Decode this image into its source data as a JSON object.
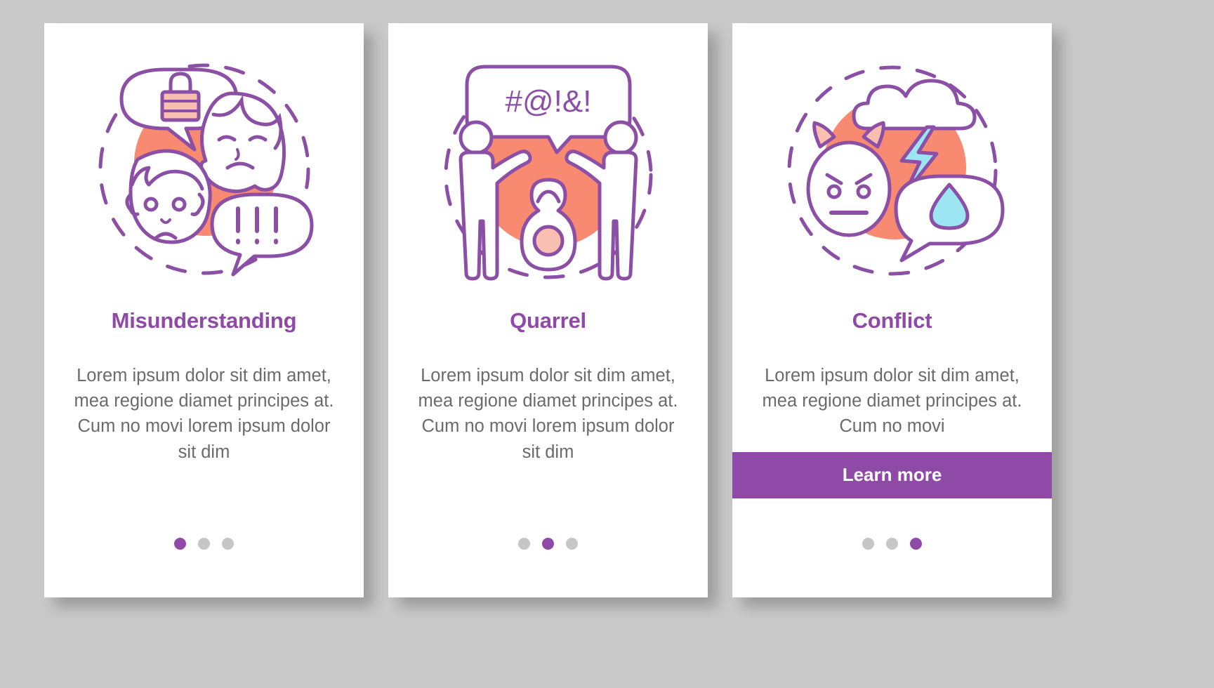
{
  "background_color": "#c9c9c9",
  "theme": {
    "accent_purple": "#8f4aa8",
    "stroke_purple": "#8b4fa5",
    "coral": "#f98a72",
    "light_pink": "#f9c0b2",
    "cyan": "#9be6f2",
    "body_text": "#6b6b6b",
    "dot_inactive": "#c6c6c6",
    "card_background": "#ffffff"
  },
  "cards": [
    {
      "id": "misunderstanding",
      "title": "Misunderstanding",
      "body": "Lorem ipsum dolor sit dim amet, mea regione diamet principes at. Cum no movi lorem ipsum dolor sit dim",
      "illustration_name": "misunderstanding-illustration",
      "illustration_elements": {
        "lock_bubble_icon": "lock-speech-bubble-icon",
        "girl_face_icon": "sad-girl-face-icon",
        "boy_face_icon": "sad-boy-face-icon",
        "exclamation_bubble_text": "!!!"
      },
      "has_button": false,
      "button_label": "",
      "active_dot": 0,
      "dots": 3
    },
    {
      "id": "quarrel",
      "title": "Quarrel",
      "body": "Lorem ipsum dolor sit dim amet, mea regione diamet principes at. Cum no movi lorem ipsum dolor sit dim",
      "illustration_name": "quarrel-illustration",
      "illustration_elements": {
        "swear_bubble_text": "#@!&!",
        "person_left_icon": "person-left-icon",
        "person_right_icon": "person-right-icon",
        "kettlebell_icon": "kettlebell-icon"
      },
      "has_button": false,
      "button_label": "",
      "active_dot": 1,
      "dots": 3
    },
    {
      "id": "conflict",
      "title": "Conflict",
      "body": "Lorem ipsum dolor sit dim amet, mea regione diamet principes at. Cum no movi",
      "illustration_name": "conflict-illustration",
      "illustration_elements": {
        "storm_cloud_icon": "storm-cloud-icon",
        "lightning_bolt_icon": "lightning-bolt-icon",
        "angry_devil_face_icon": "angry-devil-face-icon",
        "water_drop_bubble_icon": "water-drop-speech-bubble-icon"
      },
      "has_button": true,
      "button_label": "Learn more",
      "active_dot": 2,
      "dots": 3
    }
  ]
}
